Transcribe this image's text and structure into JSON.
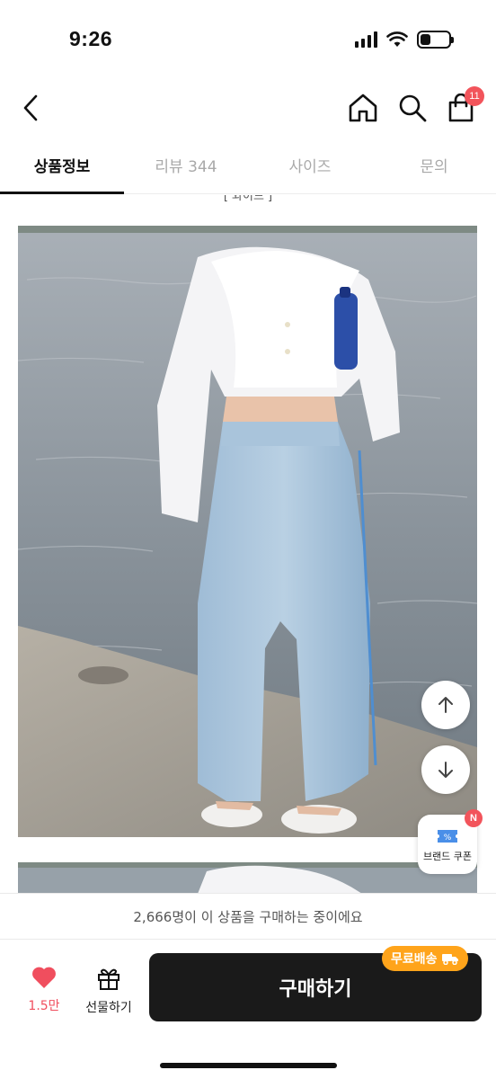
{
  "status_bar": {
    "time": "9:26",
    "battery_level": 0.35
  },
  "header": {
    "cart_badge": "11"
  },
  "tabs": [
    {
      "label": "상품정보",
      "active": true
    },
    {
      "label": "리뷰 344",
      "active": false
    },
    {
      "label": "사이즈",
      "active": false
    },
    {
      "label": "문의",
      "active": false
    }
  ],
  "content": {
    "color_caption": "[ 와이드 ]"
  },
  "floating": {
    "coupon_label": "브랜드 쿠폰",
    "coupon_badge": "N"
  },
  "buyers_banner": "2,666명이 이 상품을 구매하는 중이에요",
  "bottom_bar": {
    "like_count": "1.5만",
    "gift_label": "선물하기",
    "buy_label": "구매하기",
    "free_shipping_label": "무료배송"
  },
  "colors": {
    "accent": "#f04e5e",
    "badge": "#f2545b",
    "shipping": "#ffa41b",
    "buy_button": "#1a1a1a"
  }
}
